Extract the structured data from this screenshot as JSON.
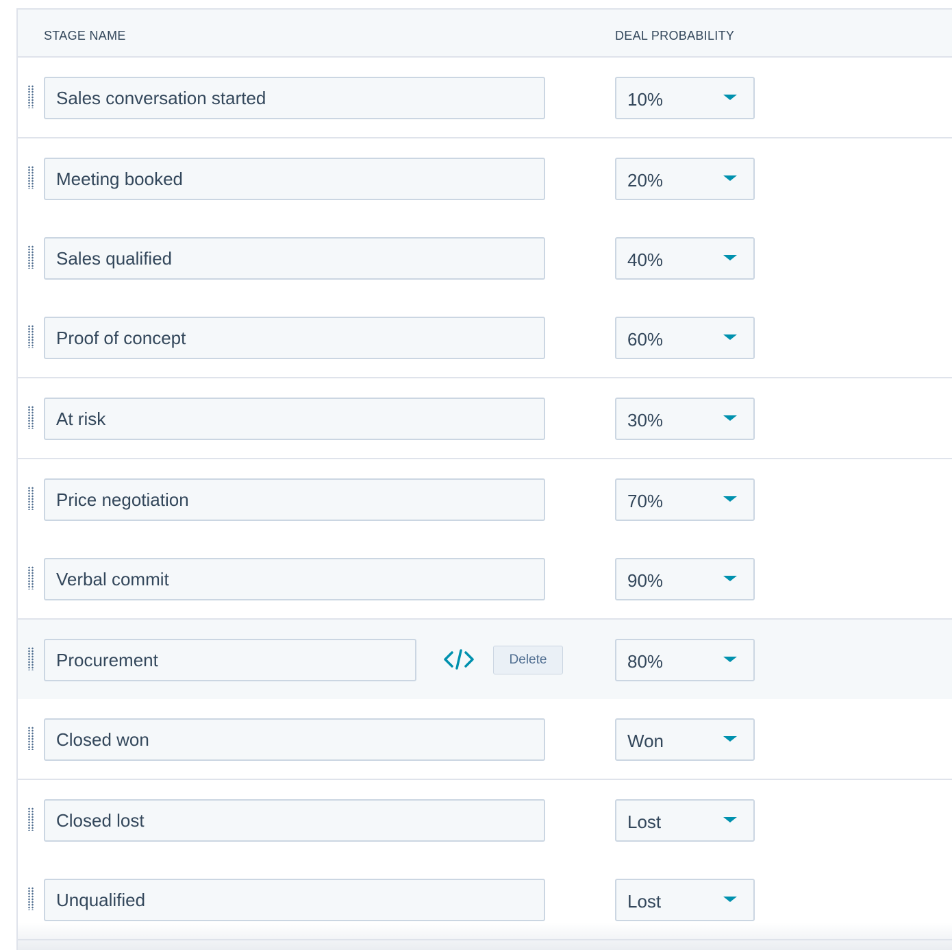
{
  "table": {
    "headers": {
      "stage_name": "STAGE NAME",
      "deal_probability": "DEAL PROBABILITY"
    },
    "rows": [
      {
        "name": "Sales conversation started",
        "probability": "10%"
      },
      {
        "name": "Meeting booked",
        "probability": "20%"
      },
      {
        "name": "Sales qualified",
        "probability": "40%"
      },
      {
        "name": "Proof of concept",
        "probability": "60%"
      },
      {
        "name": "At risk",
        "probability": "30%"
      },
      {
        "name": "Price negotiation",
        "probability": "70%"
      },
      {
        "name": "Verbal commit",
        "probability": "90%"
      },
      {
        "name": "Procurement",
        "probability": "80%",
        "delete_label": "Delete",
        "code_icon": "code-icon"
      },
      {
        "name": "Closed won",
        "probability": "Won"
      },
      {
        "name": "Closed lost",
        "probability": "Lost"
      },
      {
        "name": "Unqualified",
        "probability": "Lost"
      }
    ]
  },
  "colors": {
    "accent": "#0091ae",
    "border": "#cbd6e2",
    "text": "#33475b",
    "row_hover_bg": "#f5f8fa"
  }
}
